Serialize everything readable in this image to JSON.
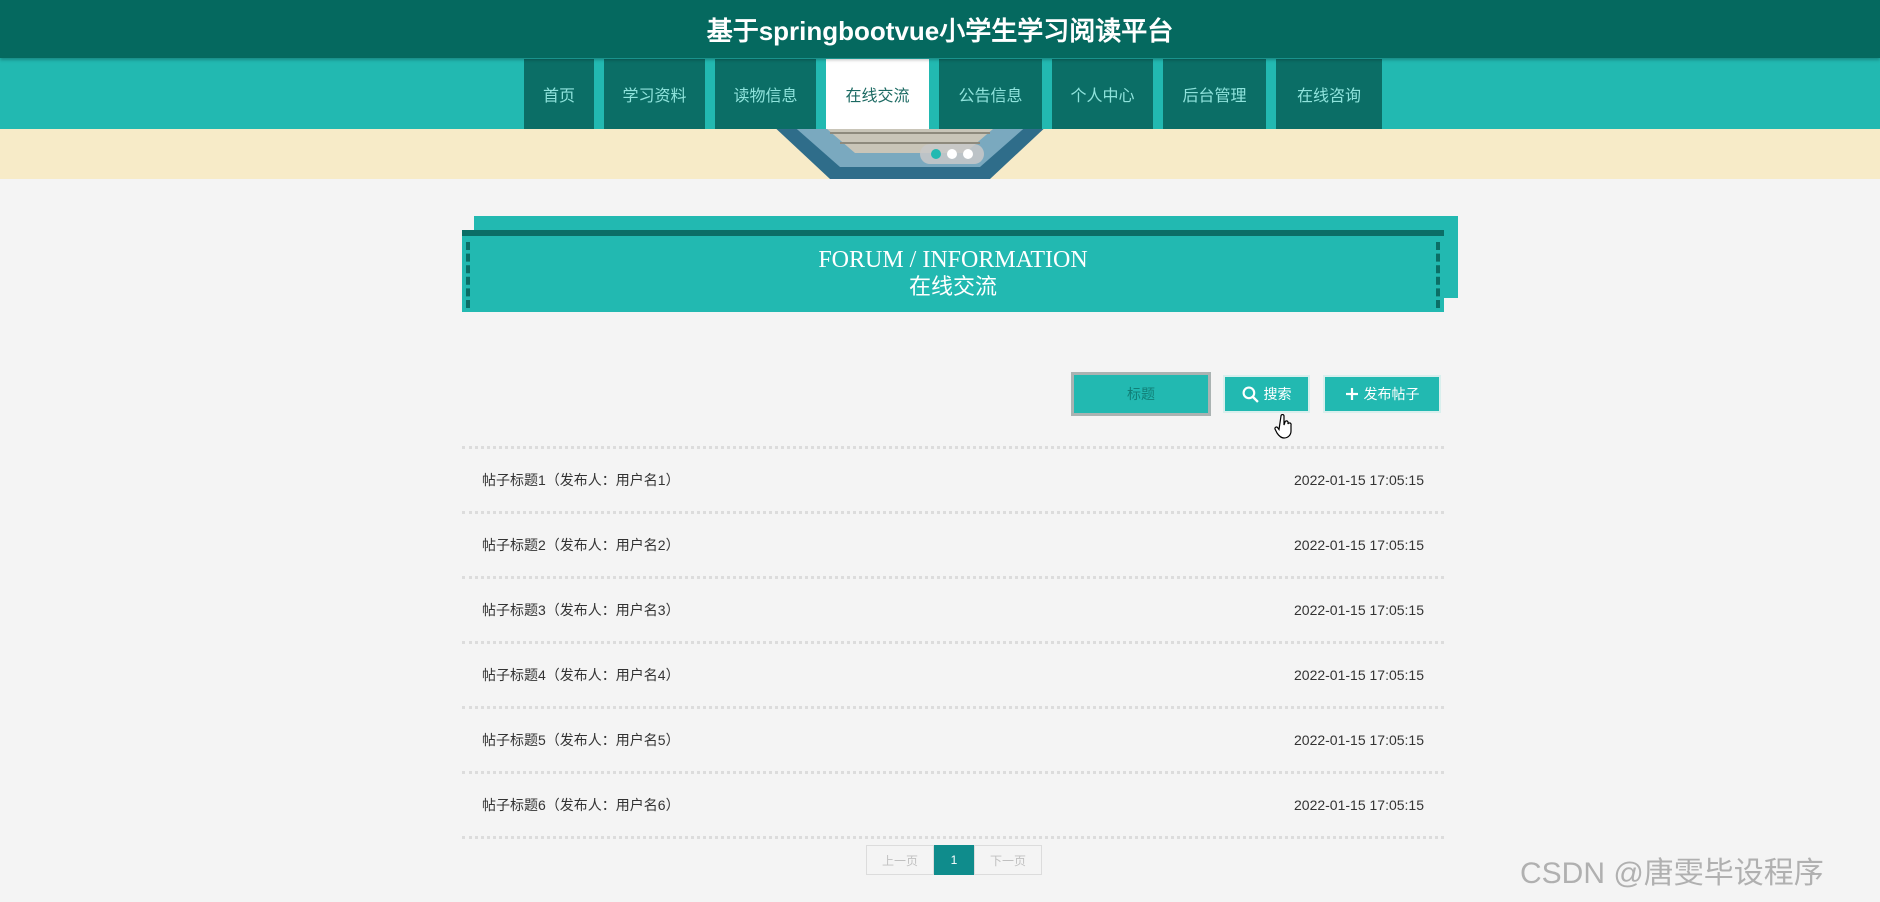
{
  "header": {
    "title": "基于springbootvue小学生学习阅读平台"
  },
  "nav": {
    "items": [
      {
        "label": "首页",
        "active": false
      },
      {
        "label": "学习资料",
        "active": false
      },
      {
        "label": "读物信息",
        "active": false
      },
      {
        "label": "在线交流",
        "active": true
      },
      {
        "label": "公告信息",
        "active": false
      },
      {
        "label": "个人中心",
        "active": false
      },
      {
        "label": "后台管理",
        "active": false
      },
      {
        "label": "在线咨询",
        "active": false
      }
    ]
  },
  "section": {
    "title_en": "FORUM / INFORMATION",
    "title_cn": "在线交流"
  },
  "search": {
    "placeholder": "标题",
    "search_label": "搜索",
    "post_label": "发布帖子"
  },
  "posts": [
    {
      "title": "帖子标题1（发布人：用户名1）",
      "time": "2022-01-15 17:05:15"
    },
    {
      "title": "帖子标题2（发布人：用户名2）",
      "time": "2022-01-15 17:05:15"
    },
    {
      "title": "帖子标题3（发布人：用户名3）",
      "time": "2022-01-15 17:05:15"
    },
    {
      "title": "帖子标题4（发布人：用户名4）",
      "time": "2022-01-15 17:05:15"
    },
    {
      "title": "帖子标题5（发布人：用户名5）",
      "time": "2022-01-15 17:05:15"
    },
    {
      "title": "帖子标题6（发布人：用户名6）",
      "time": "2022-01-15 17:05:15"
    }
  ],
  "pager": {
    "prev": "上一页",
    "current": "1",
    "next": "下一页"
  },
  "watermark": "CSDN @唐雯毕设程序",
  "colors": {
    "header": "#05695f",
    "accent": "#22b9b1",
    "nav_item": "#0b6e66",
    "banner": "#f7ebc8"
  }
}
